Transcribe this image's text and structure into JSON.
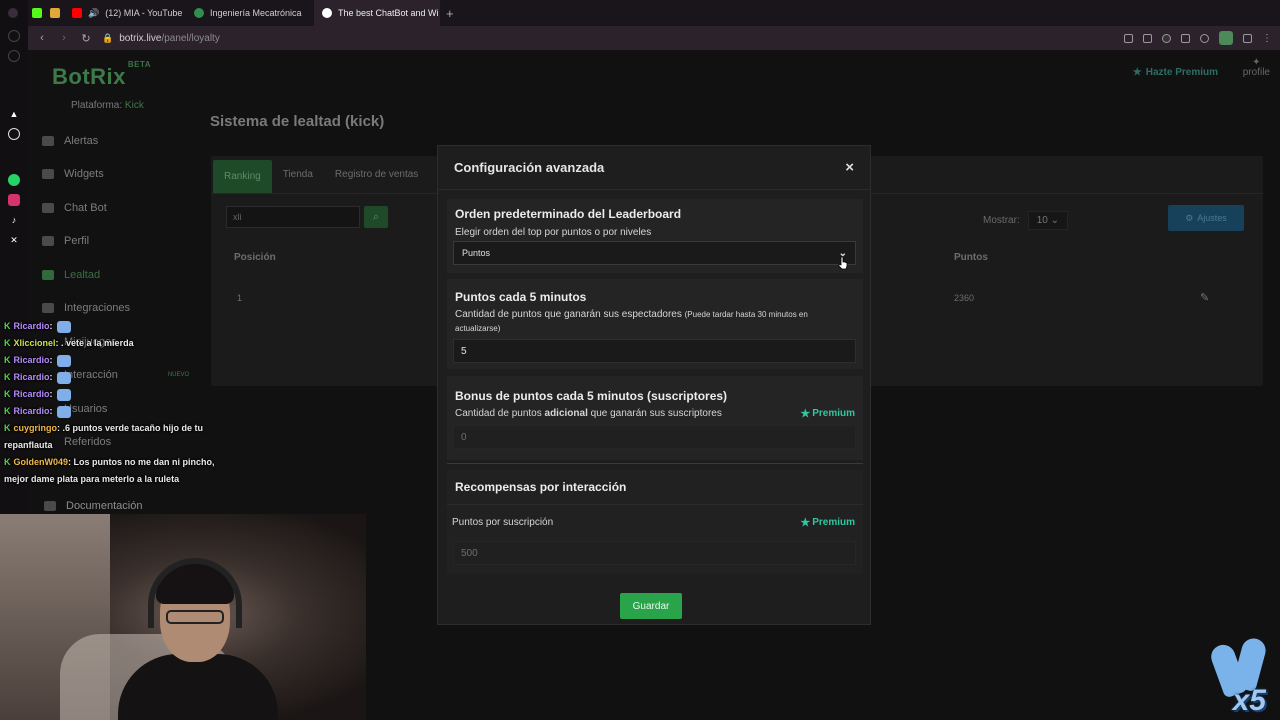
{
  "browser": {
    "tabs": [
      {
        "label": "",
        "icon": "kick-icon"
      },
      {
        "label": "(12) MIA - YouTube",
        "icon": "youtube-icon"
      },
      {
        "label": "Ingeniería Mecatrónica",
        "icon": "globe-icon"
      },
      {
        "label": "The best ChatBot and Wi",
        "icon": "botrix-icon"
      }
    ],
    "url_host": "botrix.live",
    "url_path": "/panel/loyalty"
  },
  "app": {
    "brand": "BotRix",
    "brand_badge": "BETA",
    "platform_label": "Plataforma:",
    "platform_value": "Kick",
    "nav": [
      "Alertas",
      "Widgets",
      "Chat Bot",
      "Perfil",
      "Lealtad",
      "Integraciones",
      "Minijuegos",
      "Interacción",
      "Usuarios",
      "Referidos",
      "Documentación"
    ],
    "nav_new_badge": "NUEVO",
    "premium_link": "Hazte Premium",
    "profile_label": "profile",
    "page_title": "Sistema de lealtad (kick)",
    "tabs": [
      "Ranking",
      "Tienda",
      "Registro de ventas"
    ],
    "search_value": "xli",
    "show_label": "Mostrar:",
    "show_value": "10",
    "settings_button": "Ajustes",
    "table": {
      "headers": [
        "Posición",
        "Puntos"
      ],
      "rows": [
        {
          "position": "1",
          "points": "2360"
        }
      ]
    }
  },
  "modal": {
    "title": "Configuración avanzada",
    "close": "×",
    "leaderboard": {
      "title": "Orden predeterminado del Leaderboard",
      "subtitle": "Elegir orden del top por puntos o por niveles",
      "selected": "Puntos"
    },
    "points": {
      "title": "Puntos cada 5 minutos",
      "subtitle": "Cantidad de puntos que ganarán sus espectadores",
      "note": "(Puede tardar hasta 30 minutos en actualizarse)",
      "value": "5"
    },
    "bonus": {
      "title": "Bonus de puntos cada 5 minutos (suscriptores)",
      "subtitle_pre": "Cantidad de puntos",
      "subtitle_bold": "adicional",
      "subtitle_post": "que ganarán sus suscriptores",
      "premium": "Premium",
      "placeholder": "0"
    },
    "rewards": {
      "title": "Recompensas por interacción",
      "sub_label": "Puntos por suscripción",
      "premium": "Premium",
      "placeholder": "500"
    },
    "save_button": "Guardar"
  },
  "chat": [
    {
      "user": "Ricardio",
      "text": ":",
      "emote": true,
      "color": "purple"
    },
    {
      "user": "Xliccionel",
      "text": ": . vete a la mierda",
      "emote": false,
      "color": "green"
    },
    {
      "user": "Ricardio",
      "text": ":",
      "emote": true,
      "color": "purple"
    },
    {
      "user": "Ricardio",
      "text": ":",
      "emote": true,
      "color": "purple"
    },
    {
      "user": "Ricardio",
      "text": ":",
      "emote": true,
      "color": "purple"
    },
    {
      "user": "Ricardio",
      "text": ":",
      "emote": true,
      "color": "purple"
    },
    {
      "user": "cuygringo",
      "text": ": .6 puntos verde tacaño hijo de tu repanflauta",
      "emote": false,
      "color": "orange"
    },
    {
      "user": "GoldenW049",
      "text": ": Los puntos no me dan ni pincho, mejor dame plata para meterlo a la ruleta",
      "emote": false,
      "color": "orange"
    }
  ],
  "overlay_badge": "x5",
  "colors": {
    "accent_green": "#2aa44b",
    "premium_teal": "#2fc7a0",
    "chat_badge": "#52d44c"
  }
}
